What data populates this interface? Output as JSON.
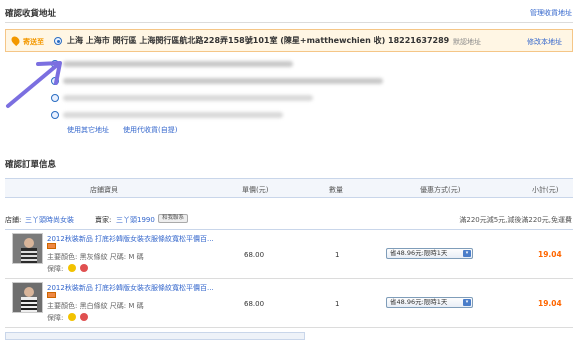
{
  "shipping": {
    "title": "確認收貨地址",
    "manage_link": "管理收貨地址",
    "send_to": "寄送至",
    "address": "上海 上海市 閔行區 上海閔行區航北路228弄158號101室 (陳星+matthewchien 收) 18221637289",
    "default_label": "默認地址",
    "edit_link": "修改本地址",
    "use_other": "使用其它地址",
    "use_agent": "使用代收貨(自提)"
  },
  "order": {
    "title": "確認訂單信息",
    "headers": {
      "shop": "店鋪寶貝",
      "price": "單價(元)",
      "qty": "數量",
      "discount": "優惠方式(元)",
      "subtotal": "小計(元)"
    },
    "shop_label": "店鋪:",
    "shop_name": "三丫頭時尚女裝",
    "seller_label": "賣家:",
    "seller_name": "三丫頭1990",
    "chat_label": "和我聯系",
    "promo": "滿220元減5元,減後滿220元,免運費",
    "items": [
      {
        "title": "2012秋裝新品 打底衫韓版女裝衣服條紋寬松平價百...",
        "attrs": "主要顏色: 黑灰條紋   尺碼: M 碼",
        "guarantee": "保障:",
        "price": "68.00",
        "qty": "1",
        "discount": "省48.96元:限時1天",
        "subtotal": "19.04"
      },
      {
        "title": "2012秋裝新品 打底衫韓版女裝衣服條紋寬松平價百...",
        "attrs": "主要顏色: 黑白條紋   尺碼: M 碼",
        "guarantee": "保障:",
        "price": "68.00",
        "qty": "1",
        "discount": "省48.96元:限時1天",
        "subtotal": "19.04"
      }
    ]
  },
  "colors": {
    "accent_orange": "#f39800",
    "link_blue": "#3366cc",
    "price_red": "#ff6600",
    "arrow_annotation": "#7b6fe0"
  }
}
